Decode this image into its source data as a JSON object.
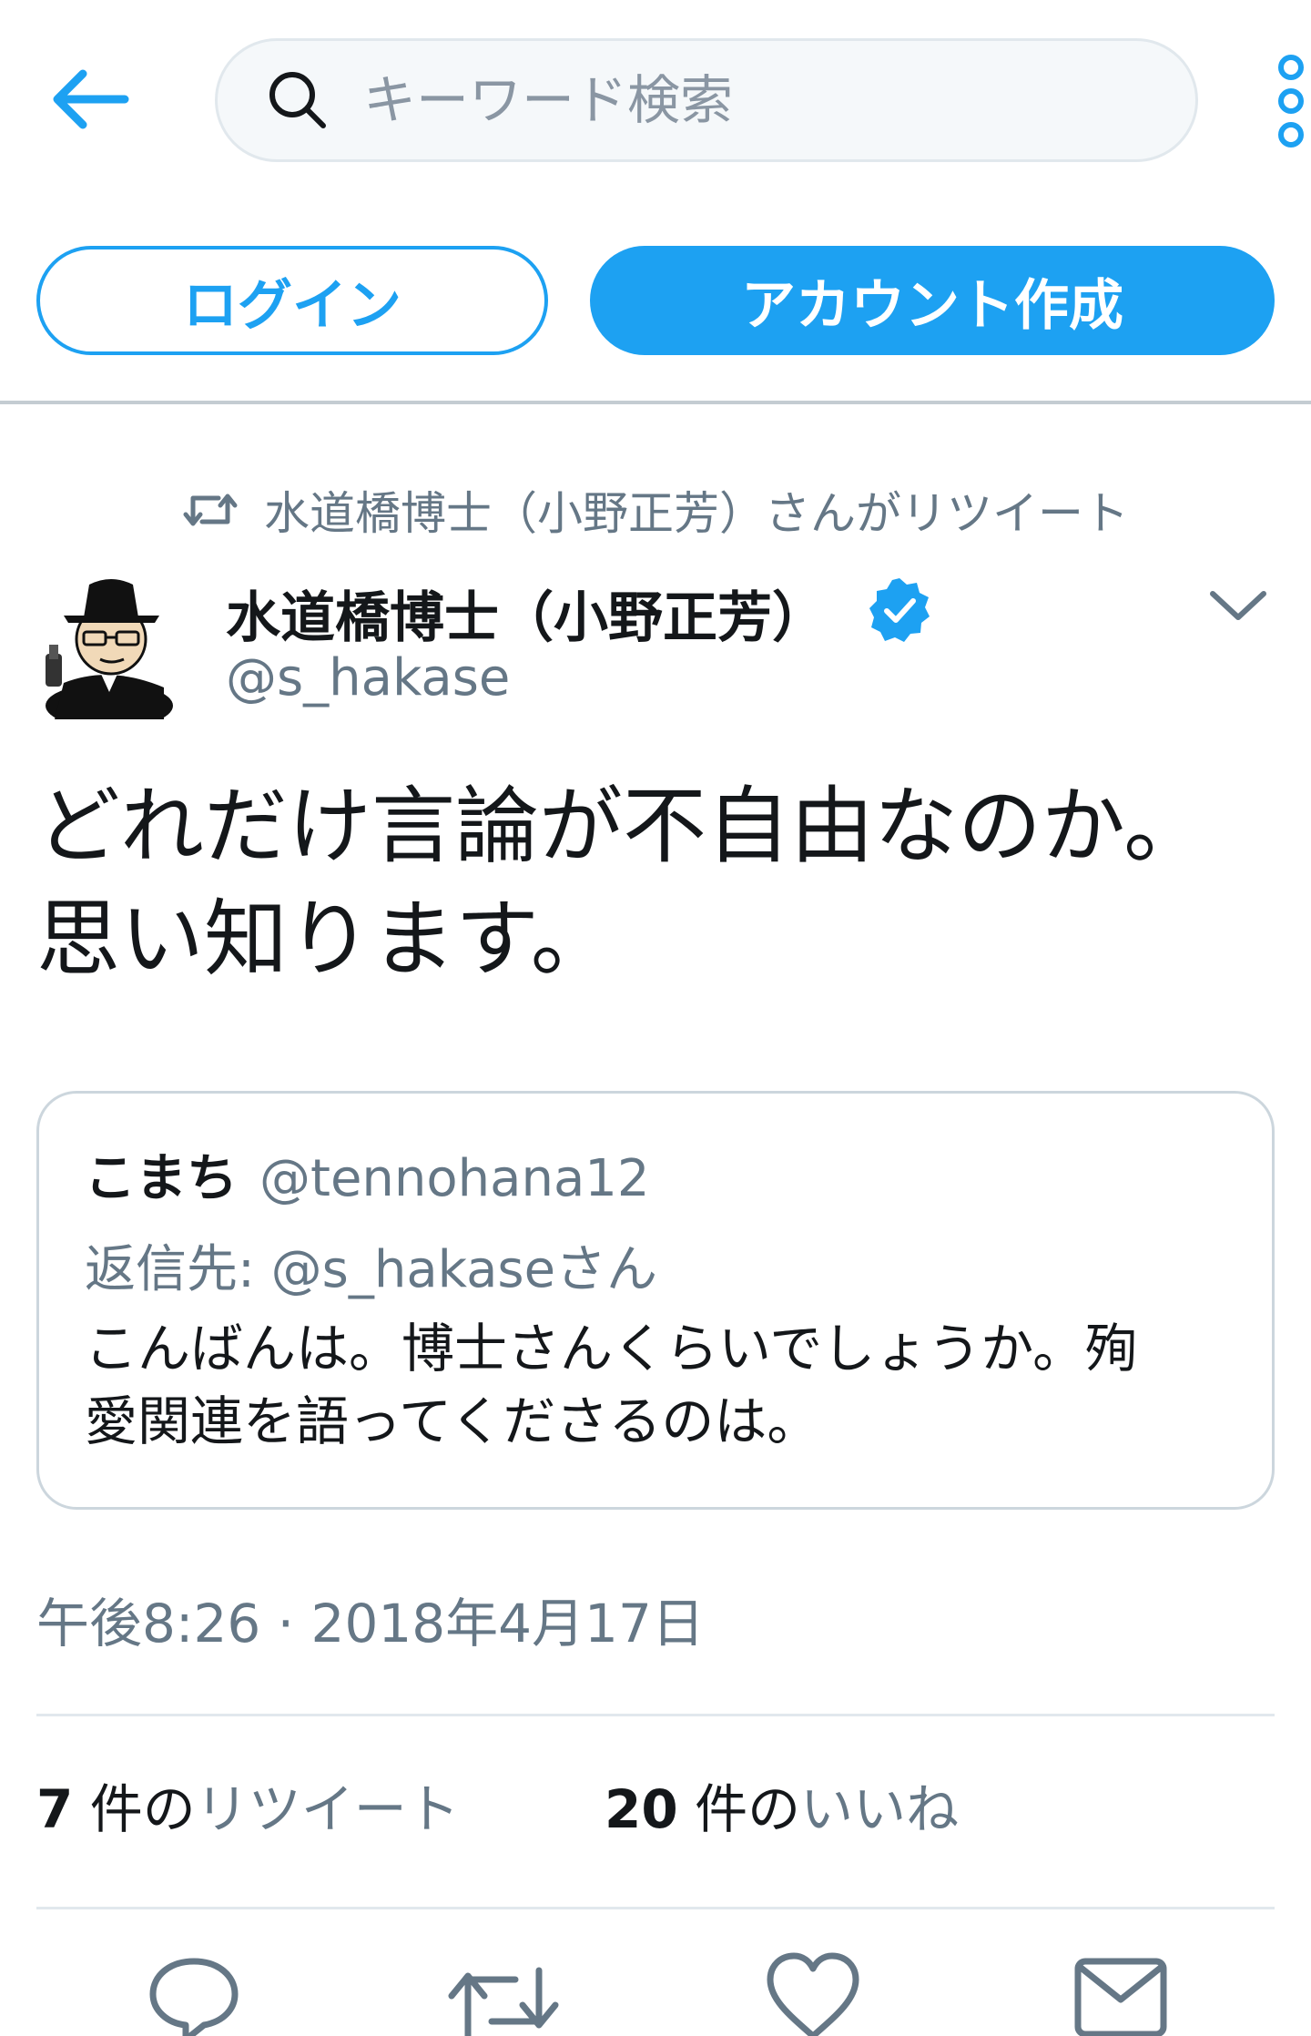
{
  "header": {
    "search_placeholder": "キーワード検索"
  },
  "auth": {
    "login_label": "ログイン",
    "signup_label": "アカウント作成"
  },
  "retweet_context": "水道橋博士（小野正芳）さんがリツイート",
  "tweet": {
    "author_name": "水道橋博士（小野正芳）",
    "author_handle": "@s_hakase",
    "verified": true,
    "text_lines": [
      "どれだけ言論が不自由なのか。",
      "思い知ります。"
    ],
    "timestamp": "午後8:26 · 2018年4月17日"
  },
  "quoted_tweet": {
    "name": "こまち",
    "handle": "@tennohana12",
    "reply_prefix": "返信先: ",
    "reply_to": "@s_hakaseさん",
    "text_lines": [
      "こんばんは。博士さんくらいでしょうか。殉",
      "愛関連を語ってくださるのは。"
    ]
  },
  "stats": {
    "retweets_count": "7",
    "retweets_unit": " 件の",
    "retweets_label": "リツイート",
    "likes_count": "20",
    "likes_unit": " 件の",
    "likes_label": "いいね"
  },
  "icons": {
    "back": "back-arrow-icon",
    "search": "search-icon",
    "more": "more-vertical-icon",
    "retweet": "retweet-icon",
    "verified": "verified-badge-icon",
    "caret": "chevron-down-icon",
    "reply": "reply-icon",
    "like": "heart-icon",
    "message": "envelope-icon"
  },
  "colors": {
    "accent": "#1da1f2",
    "text_primary": "#14171a",
    "text_secondary": "#657786",
    "border": "#ccd6dd"
  }
}
